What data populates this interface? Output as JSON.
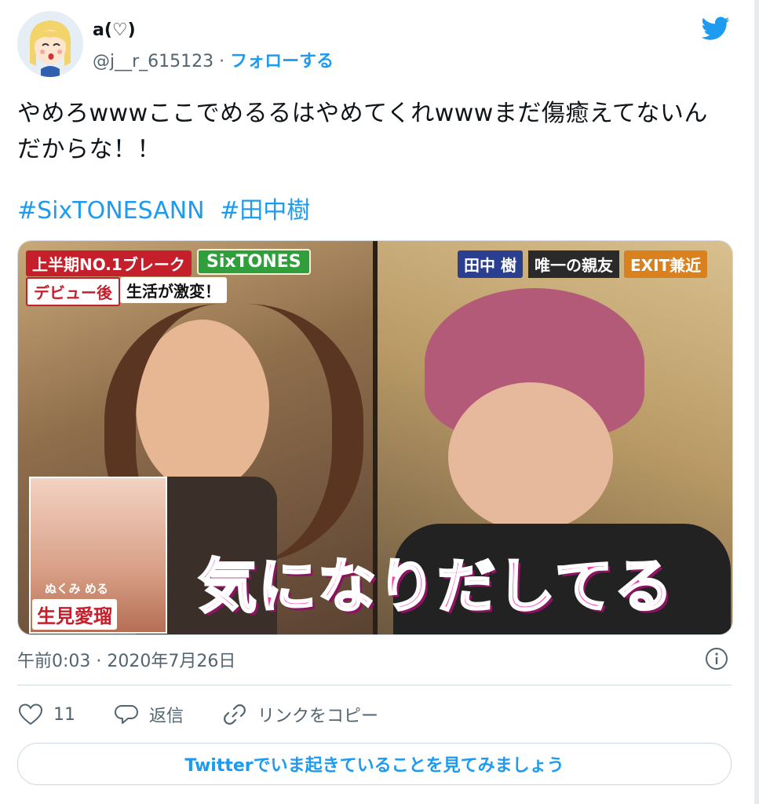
{
  "user": {
    "name": "a(♡)",
    "handle": "@j__r_615123",
    "separator": "·",
    "follow_label": "フォローする"
  },
  "tweet": {
    "text": "やめろwwwここでめるるはやめてくれwwwまだ傷癒えてないんだからな！！",
    "hashtags": [
      "#SixTONESANN",
      "#田中樹"
    ]
  },
  "media": {
    "captions": {
      "top_left": "上半期NO.1ブレーク",
      "top_left_group": "SixTONES",
      "debut": "デビュー後",
      "life": "生活が激変！",
      "right_name": "田中 樹",
      "right_mid": "唯一の親友",
      "right_tag": "EXIT兼近",
      "main": "気になりだしてる",
      "inset_name": "生見愛瑠",
      "inset_kana": "ぬくみ める"
    }
  },
  "meta": {
    "timestamp": "午前0:03 · 2020年7月26日"
  },
  "actions": {
    "like_count": "11",
    "reply_label": "返信",
    "copy_link_label": "リンクをコピー"
  },
  "cta": {
    "label": "Twitterでいま起きていることを見てみましょう"
  },
  "colors": {
    "accent": "#1d9bf0",
    "text": "#0f1419",
    "muted": "#536471",
    "border": "#cfd9de"
  },
  "icons": [
    "twitter-bird-icon",
    "info-icon",
    "heart-icon",
    "reply-icon",
    "link-icon"
  ]
}
